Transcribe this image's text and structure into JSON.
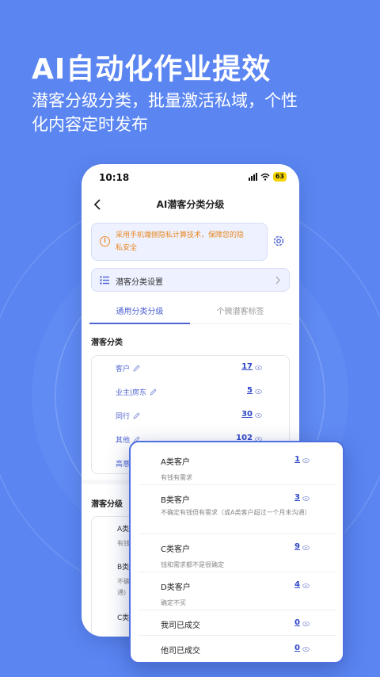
{
  "hero": {
    "headline": "AI自动化作业提效",
    "sub1": "潜客分级分类，批量激活私域，个性",
    "sub2": "化内容定时发布"
  },
  "status": {
    "time": "10:18",
    "battery": "63"
  },
  "nav": {
    "title": "AI潜客分类分级"
  },
  "notice": {
    "line1": "采用手机端侧隐私计算技术，保障您的隐",
    "line2": "私安全"
  },
  "settings": {
    "label": "潜客分类设置"
  },
  "tabs": [
    {
      "label": "通用分类分级"
    },
    {
      "label": "个微潜客标签"
    }
  ],
  "categories": {
    "title": "潜客分类",
    "rows": [
      {
        "label": "客户",
        "count": "17"
      },
      {
        "label": "业主|房东",
        "count": "5"
      },
      {
        "label": "同行",
        "count": "30"
      },
      {
        "label": "其他",
        "count": "102"
      },
      {
        "label": "高意",
        "count": ""
      }
    ]
  },
  "grading": {
    "title": "潜客分级",
    "bg_rows": [
      {
        "t": "A类",
        "d": "有钱"
      },
      {
        "t": "B类",
        "d": "不确",
        "d2": "通)"
      },
      {
        "t": "C类"
      }
    ]
  },
  "popup": {
    "rows": [
      {
        "title": "A类客户",
        "desc": "有钱有需求",
        "count": "1"
      },
      {
        "title": "B类客户",
        "desc": "不确定有钱但有需求（或A类客户超过一个月未沟通）",
        "count": "3"
      },
      {
        "title": "C类客户",
        "desc": "钱和需求都不是很确定",
        "count": "9"
      },
      {
        "title": "D类客户",
        "desc": "确定不买",
        "count": "4"
      },
      {
        "title": "我司已成交",
        "desc": "",
        "count": "0"
      },
      {
        "title": "他司已成交",
        "desc": "",
        "count": "0"
      }
    ]
  },
  "colors": {
    "background": "#5B86F2",
    "accent": "#4F63D2",
    "notice": "#E8871E"
  }
}
